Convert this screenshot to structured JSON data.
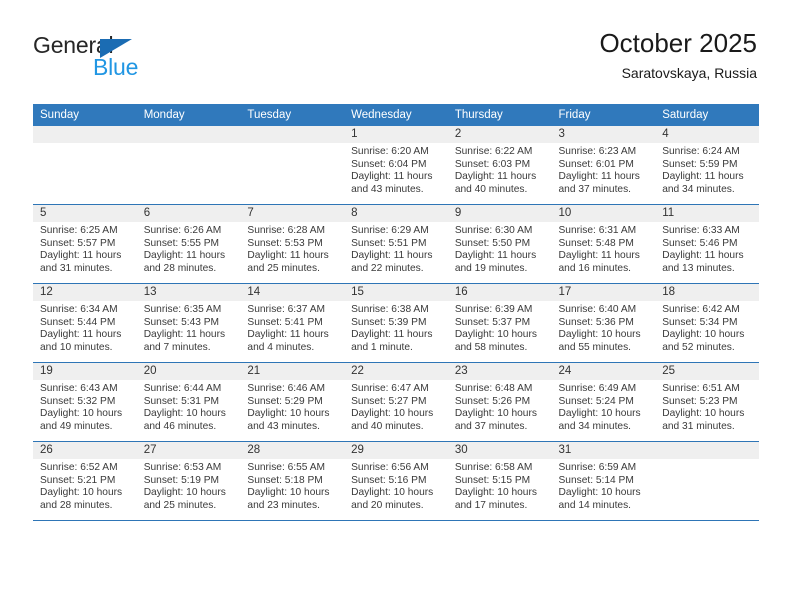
{
  "brand": {
    "name_top": "General",
    "name_bottom": "Blue",
    "triangle_color": "#1B6CB3",
    "blue_text_color": "#2196E3"
  },
  "header": {
    "title": "October 2025",
    "subtitle": "Saratovskaya, Russia"
  },
  "theme": {
    "header_row_bg": "#3079BC",
    "header_row_text": "#FFFFFF",
    "week_divider": "#2E75B6",
    "daynum_band_bg": "#EFEFEF"
  },
  "weekday_headers": [
    "Sunday",
    "Monday",
    "Tuesday",
    "Wednesday",
    "Thursday",
    "Friday",
    "Saturday"
  ],
  "weeks": [
    [
      {
        "day": "",
        "sunrise": "",
        "sunset": "",
        "daylight_line1": "",
        "daylight_line2": ""
      },
      {
        "day": "",
        "sunrise": "",
        "sunset": "",
        "daylight_line1": "",
        "daylight_line2": ""
      },
      {
        "day": "",
        "sunrise": "",
        "sunset": "",
        "daylight_line1": "",
        "daylight_line2": ""
      },
      {
        "day": "1",
        "sunrise": "Sunrise: 6:20 AM",
        "sunset": "Sunset: 6:04 PM",
        "daylight_line1": "Daylight: 11 hours",
        "daylight_line2": "and 43 minutes."
      },
      {
        "day": "2",
        "sunrise": "Sunrise: 6:22 AM",
        "sunset": "Sunset: 6:03 PM",
        "daylight_line1": "Daylight: 11 hours",
        "daylight_line2": "and 40 minutes."
      },
      {
        "day": "3",
        "sunrise": "Sunrise: 6:23 AM",
        "sunset": "Sunset: 6:01 PM",
        "daylight_line1": "Daylight: 11 hours",
        "daylight_line2": "and 37 minutes."
      },
      {
        "day": "4",
        "sunrise": "Sunrise: 6:24 AM",
        "sunset": "Sunset: 5:59 PM",
        "daylight_line1": "Daylight: 11 hours",
        "daylight_line2": "and 34 minutes."
      }
    ],
    [
      {
        "day": "5",
        "sunrise": "Sunrise: 6:25 AM",
        "sunset": "Sunset: 5:57 PM",
        "daylight_line1": "Daylight: 11 hours",
        "daylight_line2": "and 31 minutes."
      },
      {
        "day": "6",
        "sunrise": "Sunrise: 6:26 AM",
        "sunset": "Sunset: 5:55 PM",
        "daylight_line1": "Daylight: 11 hours",
        "daylight_line2": "and 28 minutes."
      },
      {
        "day": "7",
        "sunrise": "Sunrise: 6:28 AM",
        "sunset": "Sunset: 5:53 PM",
        "daylight_line1": "Daylight: 11 hours",
        "daylight_line2": "and 25 minutes."
      },
      {
        "day": "8",
        "sunrise": "Sunrise: 6:29 AM",
        "sunset": "Sunset: 5:51 PM",
        "daylight_line1": "Daylight: 11 hours",
        "daylight_line2": "and 22 minutes."
      },
      {
        "day": "9",
        "sunrise": "Sunrise: 6:30 AM",
        "sunset": "Sunset: 5:50 PM",
        "daylight_line1": "Daylight: 11 hours",
        "daylight_line2": "and 19 minutes."
      },
      {
        "day": "10",
        "sunrise": "Sunrise: 6:31 AM",
        "sunset": "Sunset: 5:48 PM",
        "daylight_line1": "Daylight: 11 hours",
        "daylight_line2": "and 16 minutes."
      },
      {
        "day": "11",
        "sunrise": "Sunrise: 6:33 AM",
        "sunset": "Sunset: 5:46 PM",
        "daylight_line1": "Daylight: 11 hours",
        "daylight_line2": "and 13 minutes."
      }
    ],
    [
      {
        "day": "12",
        "sunrise": "Sunrise: 6:34 AM",
        "sunset": "Sunset: 5:44 PM",
        "daylight_line1": "Daylight: 11 hours",
        "daylight_line2": "and 10 minutes."
      },
      {
        "day": "13",
        "sunrise": "Sunrise: 6:35 AM",
        "sunset": "Sunset: 5:43 PM",
        "daylight_line1": "Daylight: 11 hours",
        "daylight_line2": "and 7 minutes."
      },
      {
        "day": "14",
        "sunrise": "Sunrise: 6:37 AM",
        "sunset": "Sunset: 5:41 PM",
        "daylight_line1": "Daylight: 11 hours",
        "daylight_line2": "and 4 minutes."
      },
      {
        "day": "15",
        "sunrise": "Sunrise: 6:38 AM",
        "sunset": "Sunset: 5:39 PM",
        "daylight_line1": "Daylight: 11 hours",
        "daylight_line2": "and 1 minute."
      },
      {
        "day": "16",
        "sunrise": "Sunrise: 6:39 AM",
        "sunset": "Sunset: 5:37 PM",
        "daylight_line1": "Daylight: 10 hours",
        "daylight_line2": "and 58 minutes."
      },
      {
        "day": "17",
        "sunrise": "Sunrise: 6:40 AM",
        "sunset": "Sunset: 5:36 PM",
        "daylight_line1": "Daylight: 10 hours",
        "daylight_line2": "and 55 minutes."
      },
      {
        "day": "18",
        "sunrise": "Sunrise: 6:42 AM",
        "sunset": "Sunset: 5:34 PM",
        "daylight_line1": "Daylight: 10 hours",
        "daylight_line2": "and 52 minutes."
      }
    ],
    [
      {
        "day": "19",
        "sunrise": "Sunrise: 6:43 AM",
        "sunset": "Sunset: 5:32 PM",
        "daylight_line1": "Daylight: 10 hours",
        "daylight_line2": "and 49 minutes."
      },
      {
        "day": "20",
        "sunrise": "Sunrise: 6:44 AM",
        "sunset": "Sunset: 5:31 PM",
        "daylight_line1": "Daylight: 10 hours",
        "daylight_line2": "and 46 minutes."
      },
      {
        "day": "21",
        "sunrise": "Sunrise: 6:46 AM",
        "sunset": "Sunset: 5:29 PM",
        "daylight_line1": "Daylight: 10 hours",
        "daylight_line2": "and 43 minutes."
      },
      {
        "day": "22",
        "sunrise": "Sunrise: 6:47 AM",
        "sunset": "Sunset: 5:27 PM",
        "daylight_line1": "Daylight: 10 hours",
        "daylight_line2": "and 40 minutes."
      },
      {
        "day": "23",
        "sunrise": "Sunrise: 6:48 AM",
        "sunset": "Sunset: 5:26 PM",
        "daylight_line1": "Daylight: 10 hours",
        "daylight_line2": "and 37 minutes."
      },
      {
        "day": "24",
        "sunrise": "Sunrise: 6:49 AM",
        "sunset": "Sunset: 5:24 PM",
        "daylight_line1": "Daylight: 10 hours",
        "daylight_line2": "and 34 minutes."
      },
      {
        "day": "25",
        "sunrise": "Sunrise: 6:51 AM",
        "sunset": "Sunset: 5:23 PM",
        "daylight_line1": "Daylight: 10 hours",
        "daylight_line2": "and 31 minutes."
      }
    ],
    [
      {
        "day": "26",
        "sunrise": "Sunrise: 6:52 AM",
        "sunset": "Sunset: 5:21 PM",
        "daylight_line1": "Daylight: 10 hours",
        "daylight_line2": "and 28 minutes."
      },
      {
        "day": "27",
        "sunrise": "Sunrise: 6:53 AM",
        "sunset": "Sunset: 5:19 PM",
        "daylight_line1": "Daylight: 10 hours",
        "daylight_line2": "and 25 minutes."
      },
      {
        "day": "28",
        "sunrise": "Sunrise: 6:55 AM",
        "sunset": "Sunset: 5:18 PM",
        "daylight_line1": "Daylight: 10 hours",
        "daylight_line2": "and 23 minutes."
      },
      {
        "day": "29",
        "sunrise": "Sunrise: 6:56 AM",
        "sunset": "Sunset: 5:16 PM",
        "daylight_line1": "Daylight: 10 hours",
        "daylight_line2": "and 20 minutes."
      },
      {
        "day": "30",
        "sunrise": "Sunrise: 6:58 AM",
        "sunset": "Sunset: 5:15 PM",
        "daylight_line1": "Daylight: 10 hours",
        "daylight_line2": "and 17 minutes."
      },
      {
        "day": "31",
        "sunrise": "Sunrise: 6:59 AM",
        "sunset": "Sunset: 5:14 PM",
        "daylight_line1": "Daylight: 10 hours",
        "daylight_line2": "and 14 minutes."
      },
      {
        "day": "",
        "sunrise": "",
        "sunset": "",
        "daylight_line1": "",
        "daylight_line2": ""
      }
    ]
  ]
}
